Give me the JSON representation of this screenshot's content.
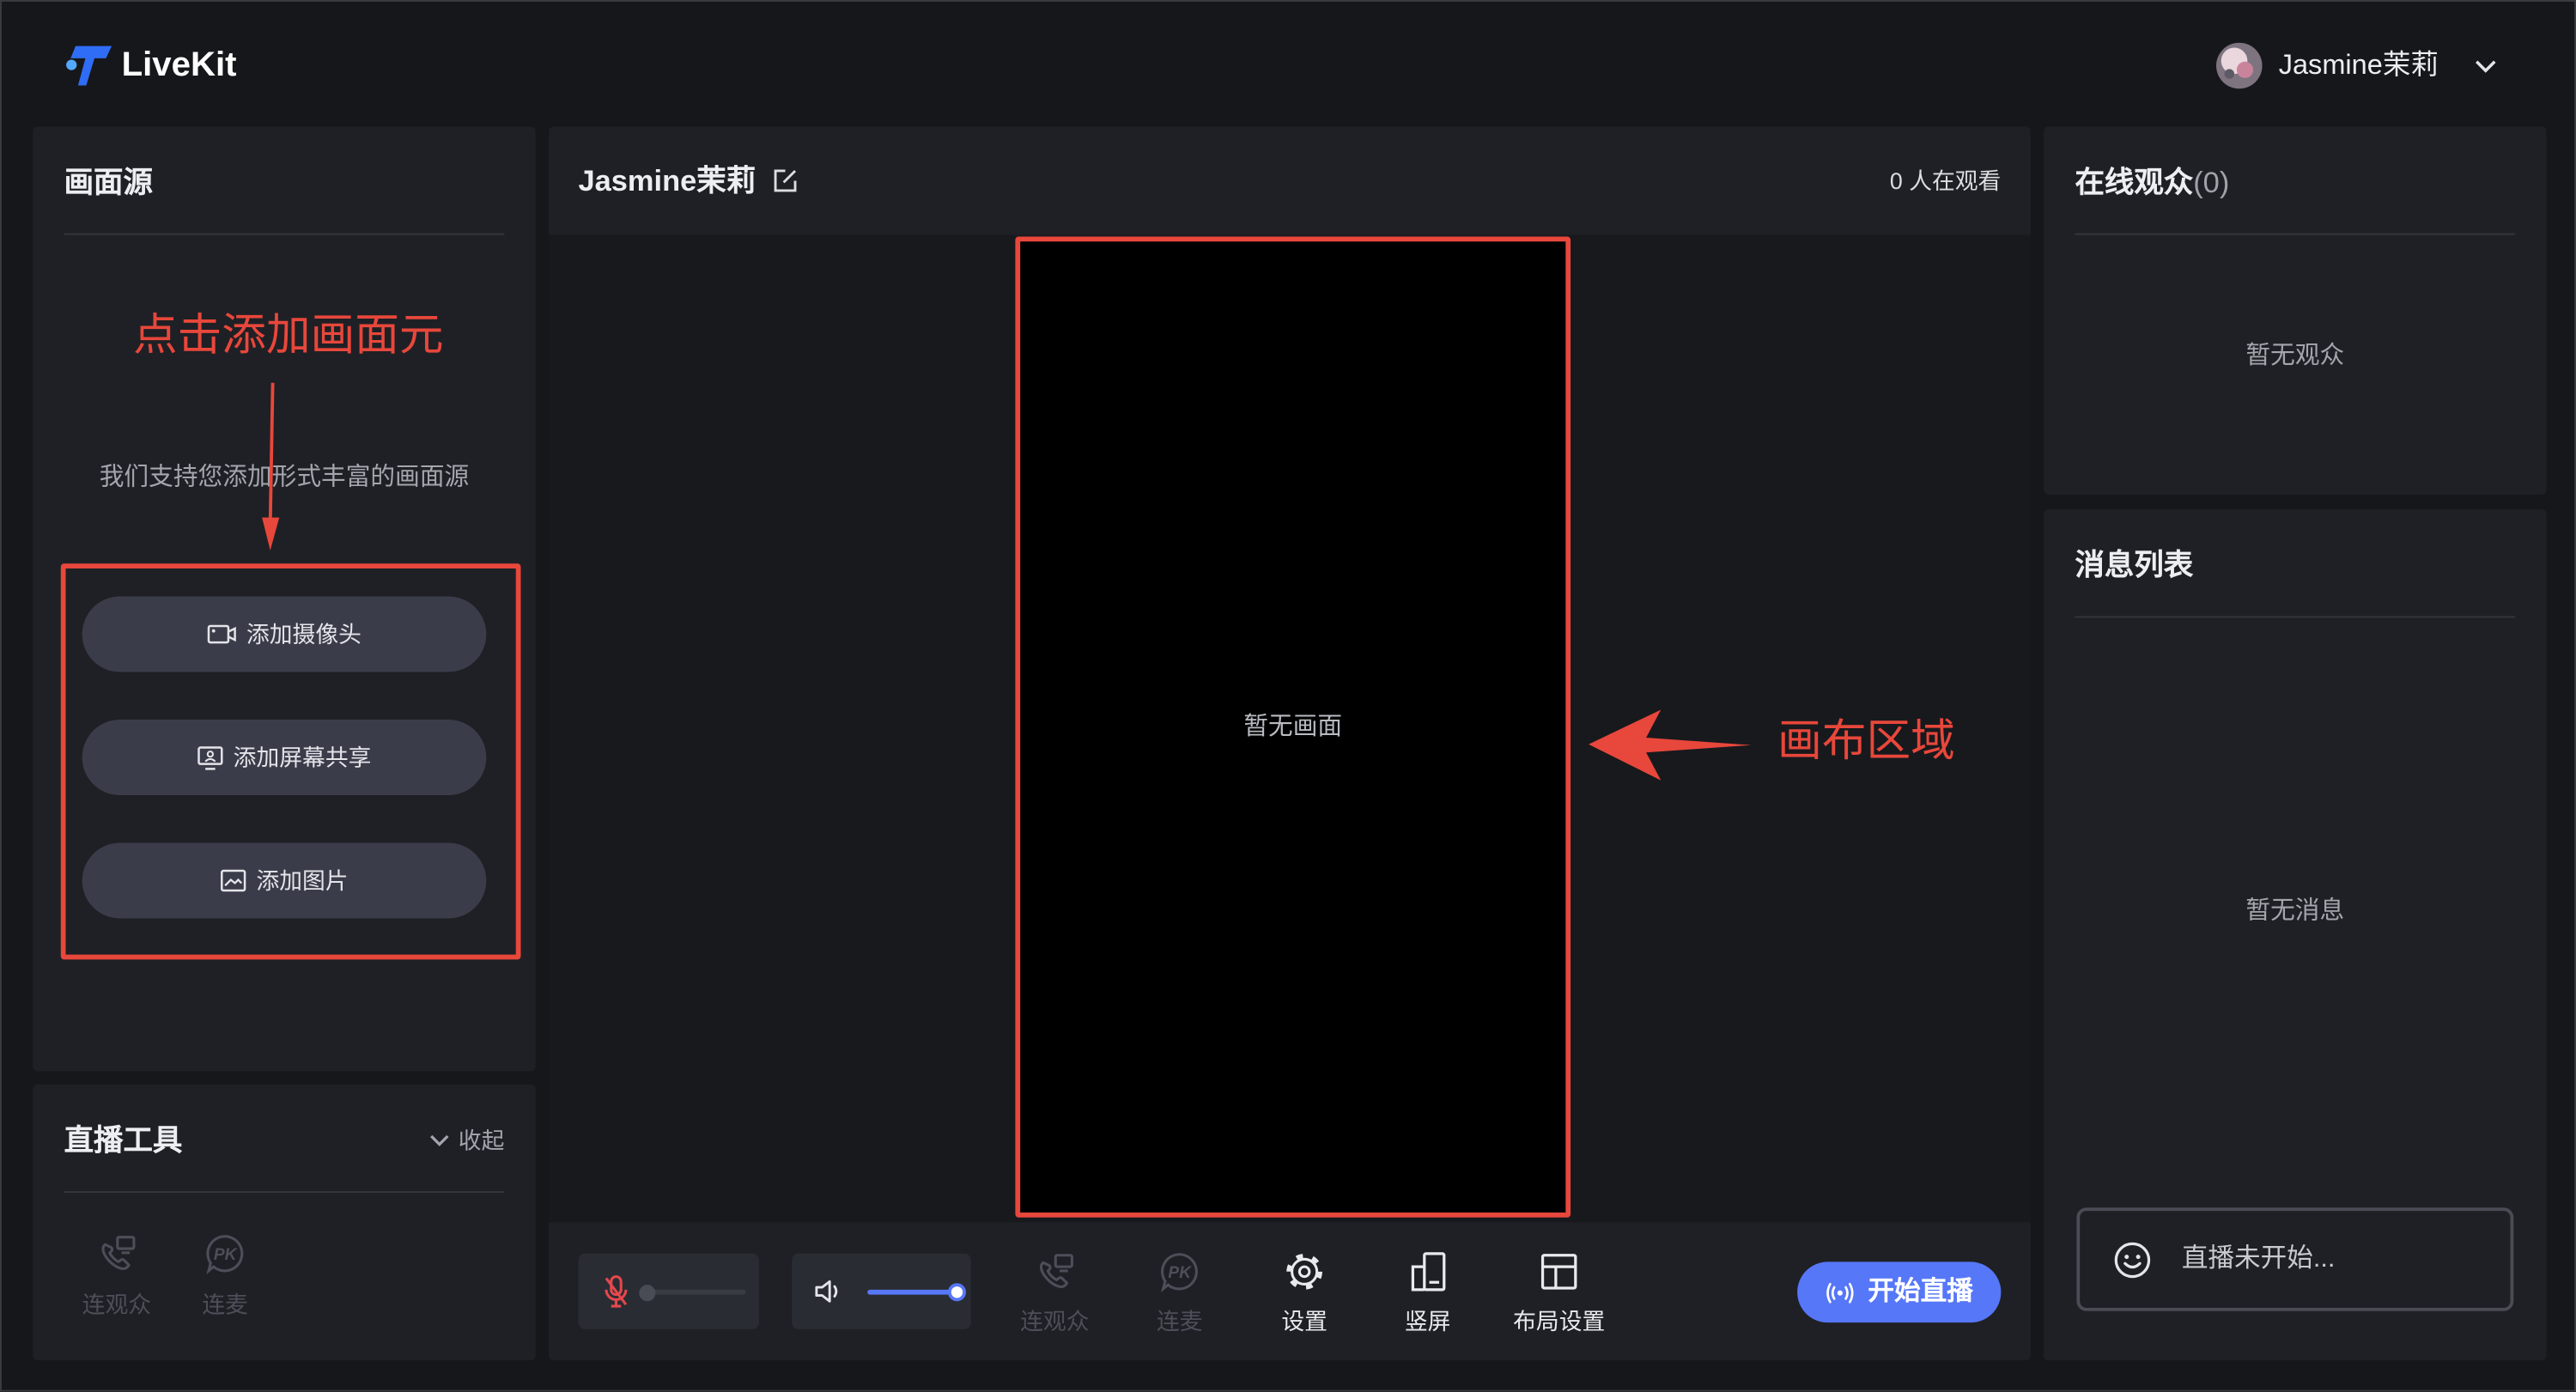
{
  "app": {
    "name": "LiveKit",
    "logo_icon": "livekit-logo-icon"
  },
  "user": {
    "name": "Jasmine茉莉",
    "avatar_icon": "avatar",
    "menu_icon": "chevron-down-icon"
  },
  "sources_panel": {
    "title": "画面源",
    "hint": "我们支持您添加形式丰富的画面源",
    "buttons": [
      {
        "label": "添加摄像头",
        "icon": "camera-icon"
      },
      {
        "label": "添加屏幕共享",
        "icon": "screen-share-icon"
      },
      {
        "label": "添加图片",
        "icon": "image-icon"
      }
    ]
  },
  "tools_panel": {
    "title": "直播工具",
    "collapse_label": "收起",
    "collapse_icon": "chevron-down-icon",
    "items": [
      {
        "label": "连观众",
        "icon": "link-audience-icon",
        "enabled": false
      },
      {
        "label": "连麦",
        "icon": "pk-icon",
        "enabled": false
      }
    ]
  },
  "stage": {
    "title": "Jasmine茉莉",
    "title_icon": "edit-icon",
    "viewers": "0 人在观看",
    "canvas_empty": "暂无画面"
  },
  "toolbar": {
    "mic": {
      "icon": "mic-muted-icon",
      "muted": true,
      "level": 0
    },
    "speaker": {
      "icon": "speaker-icon",
      "level": 1
    },
    "items": [
      {
        "label": "连观众",
        "icon": "link-audience-icon",
        "enabled": false
      },
      {
        "label": "连麦",
        "icon": "pk-icon",
        "enabled": false
      },
      {
        "label": "设置",
        "icon": "gear-icon",
        "enabled": true
      },
      {
        "label": "竖屏",
        "icon": "portrait-icon",
        "enabled": true
      },
      {
        "label": "布局设置",
        "icon": "layout-icon",
        "enabled": true
      }
    ],
    "start_button": {
      "label": "开始直播",
      "icon": "broadcast-icon"
    }
  },
  "icons": {
    "pk_glyph": "PK"
  },
  "audience": {
    "title": "在线观众",
    "count": "(0)",
    "empty": "暂无观众"
  },
  "messages": {
    "title": "消息列表",
    "empty": "暂无消息",
    "placeholder": "直播未开始...",
    "input_icon": "smile-icon"
  },
  "annotations": {
    "add_source": "点击添加画面元",
    "canvas_area": "画布区域"
  },
  "colors": {
    "background": "#16171b",
    "panel": "#1f2025",
    "accent": "#5677f7",
    "annotation": "#e8473b",
    "mic_muted": "#e5484d",
    "disabled": "#4c4f59"
  }
}
